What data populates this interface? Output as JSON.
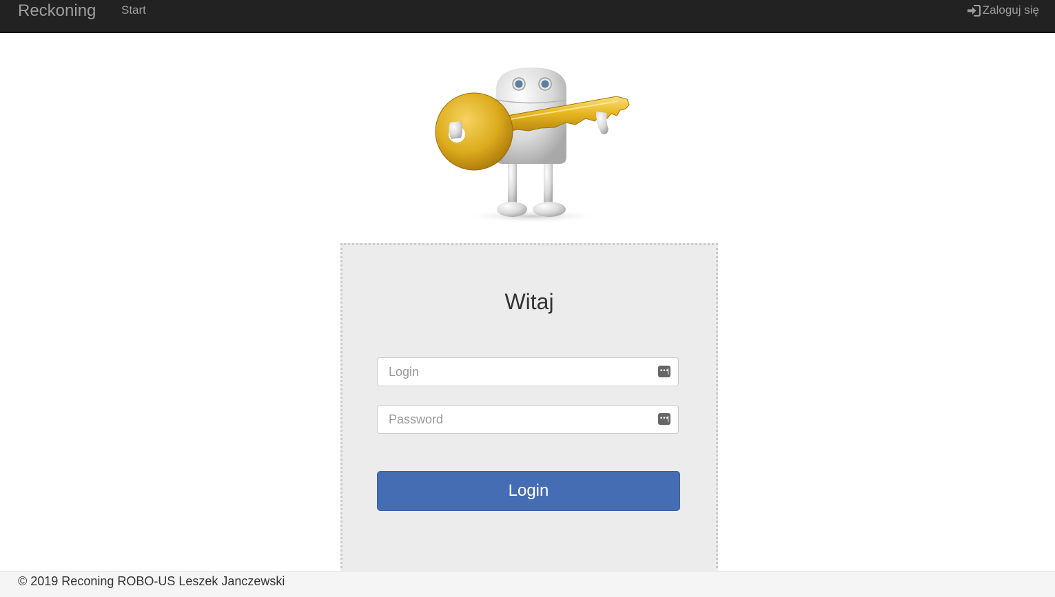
{
  "navbar": {
    "brand": "Reckoning",
    "start_label": "Start",
    "login_label": "Zaloguj się",
    "login_icon": "log-in-icon"
  },
  "hero": {
    "image": "robot-with-key-illustration"
  },
  "panel": {
    "title": "Witaj",
    "login_field": {
      "placeholder": "Login",
      "value": "",
      "icon": "password-manager-icon"
    },
    "password_field": {
      "placeholder": "Password",
      "value": "",
      "icon": "password-manager-icon"
    },
    "submit_label": "Login"
  },
  "footer": {
    "text": "© 2019 Reconing ROBO-US Leszek Janczewski"
  },
  "colors": {
    "navbar_bg": "#222222",
    "nav_text": "#9d9d9d",
    "panel_bg": "#ececec",
    "button_bg": "#456db3",
    "key_gold": "#e2b21c"
  }
}
